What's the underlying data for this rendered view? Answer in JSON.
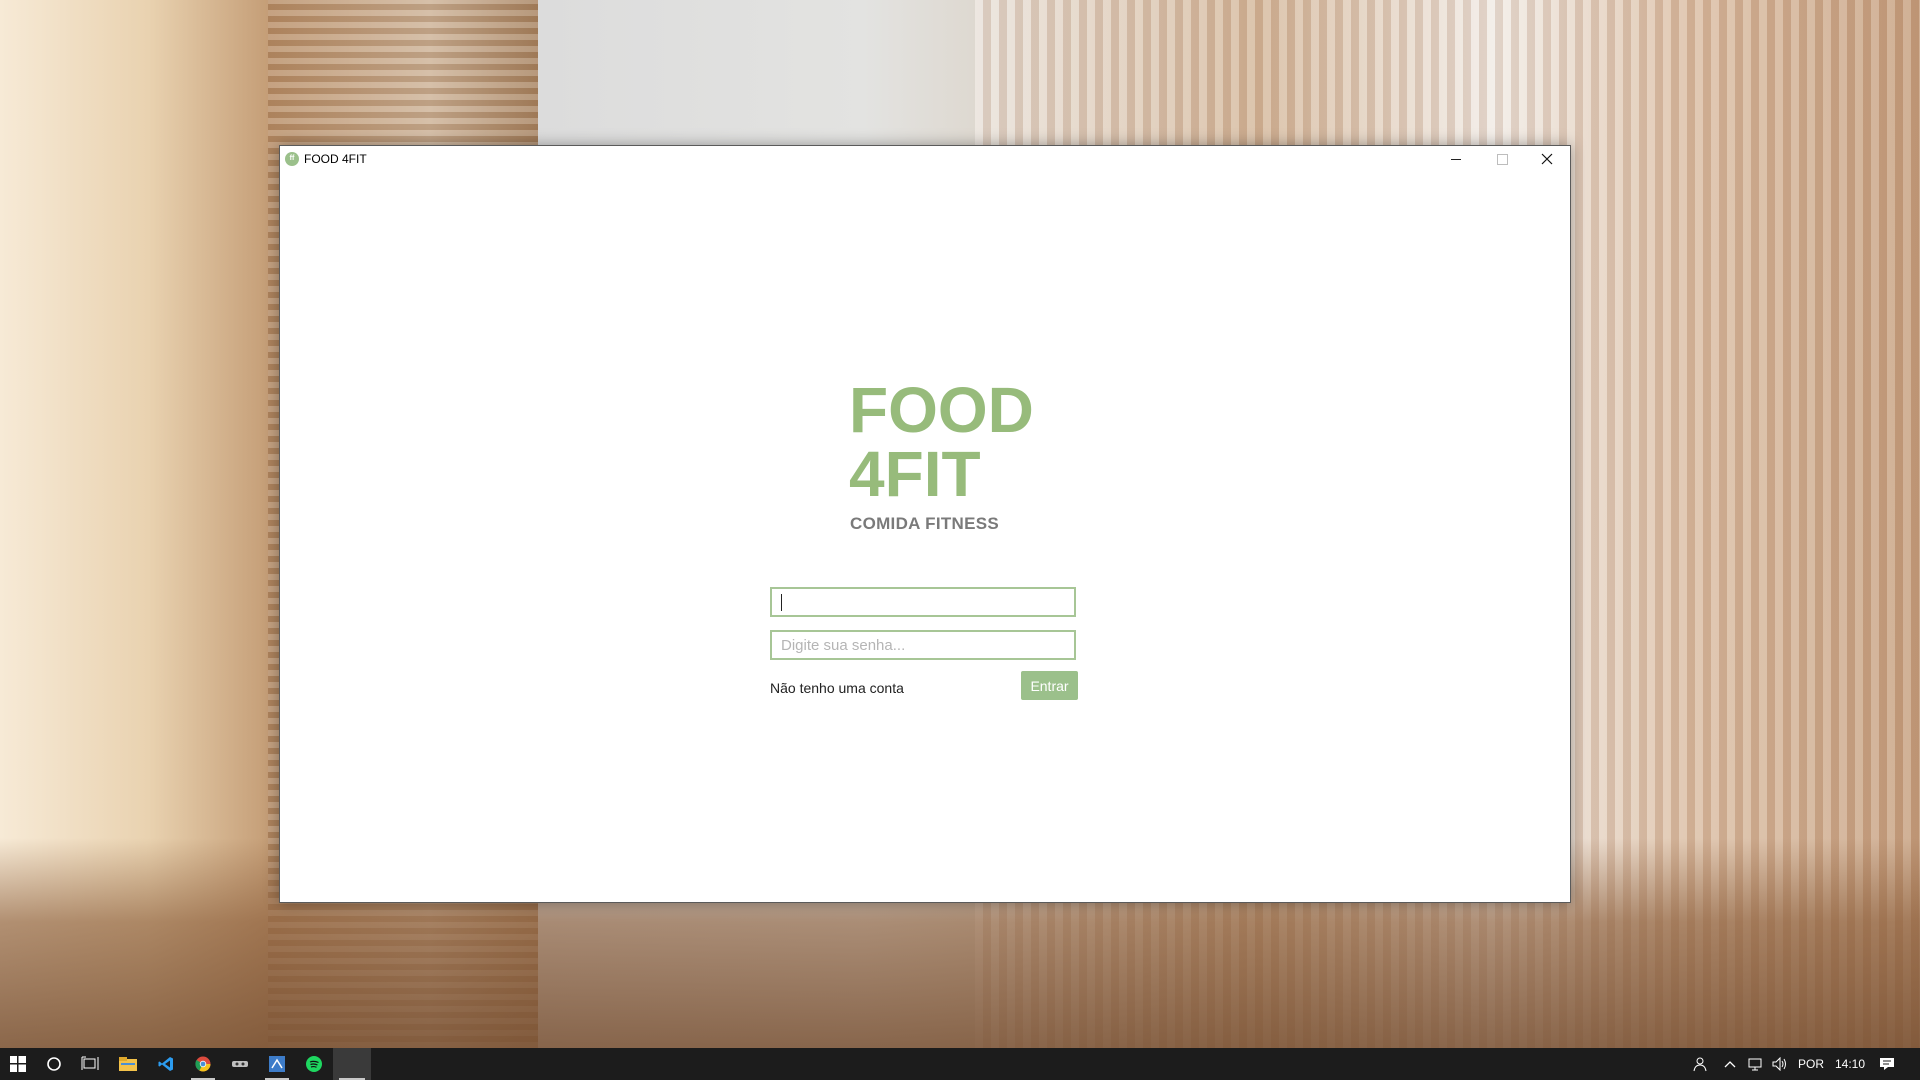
{
  "window": {
    "title": "FOOD 4FIT",
    "icon": "app-leaf-icon"
  },
  "app": {
    "brand_line1": "FOOD",
    "brand_line2": "4FIT",
    "subtitle": "COMIDA FITNESS",
    "username_value": "",
    "password_placeholder": "Digite sua senha...",
    "signup_link": "Não tenho uma conta",
    "enter_button": "Entrar",
    "accent_color": "#9bc08b"
  },
  "taskbar": {
    "icons": [
      "start-icon",
      "search-icon",
      "task-view-icon",
      "file-explorer-icon",
      "vscode-icon",
      "chrome-icon",
      "app-icon",
      "app-icon",
      "spotify-icon",
      "app-icon"
    ],
    "language": "POR",
    "time": "14:10"
  }
}
